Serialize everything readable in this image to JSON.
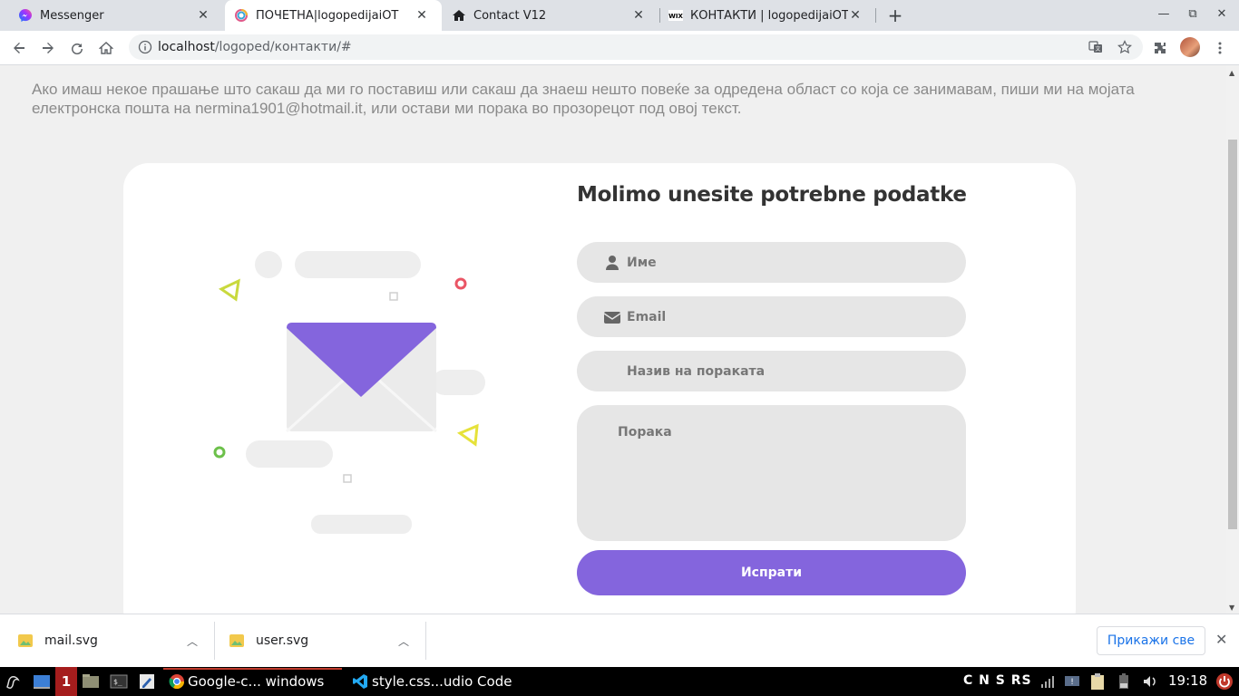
{
  "browser": {
    "tabs": [
      {
        "title": "Messenger",
        "icon": "messenger-icon",
        "active": false
      },
      {
        "title": "ПОЧЕТНА|logopedijaiOT",
        "icon": "logo-icon",
        "active": true
      },
      {
        "title": "Contact V12",
        "icon": "home-icon",
        "active": false
      },
      {
        "title": "КОНТАКТИ | logopedijaiOT",
        "icon": "wix-icon",
        "active": false
      }
    ],
    "url_host": "localhost",
    "url_path": "/logoped/контакти/#"
  },
  "page": {
    "intro": "Ако имаш некое прашање што сакаш да ми го поставиш или сакаш да знаеш нешто повеќе за одредена област со која се занимавам, пиши ми на мојата електронска пошта на nermina1901@hotmail.it, или остави ми порака во прозорецот под овој текст.",
    "form": {
      "title": "Molimo unesite potrebne podatke",
      "name_placeholder": "Име",
      "email_placeholder": "Email",
      "subject_placeholder": "Назив на пораката",
      "message_placeholder": "Порака",
      "submit_label": "Испрати"
    },
    "colors": {
      "accent": "#8465dd",
      "field_bg": "#e6e6e6"
    }
  },
  "downloads": {
    "items": [
      {
        "name": "mail.svg"
      },
      {
        "name": "user.svg"
      }
    ],
    "show_all": "Прикажи све"
  },
  "taskbar": {
    "workspace": "1",
    "chrome_label": "Google-c... windows",
    "vscode_label": "style.css...udio Code",
    "tray_text": "C N S RS",
    "clock": "19:18"
  }
}
